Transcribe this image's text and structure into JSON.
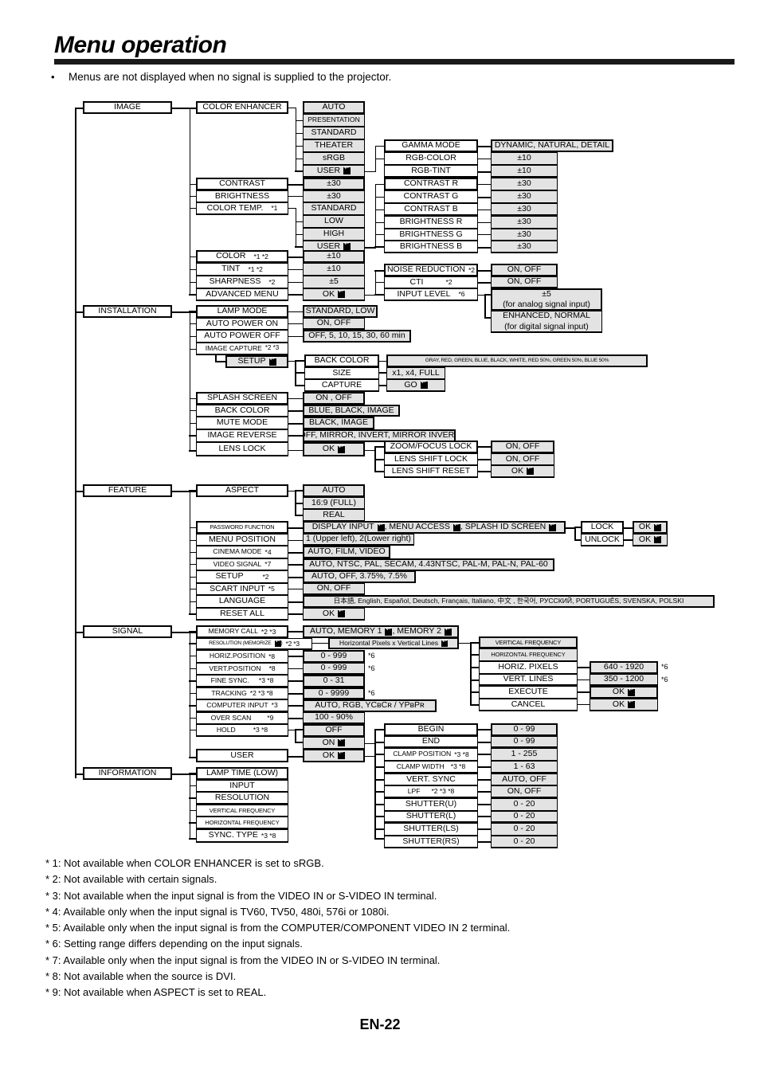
{
  "header": {
    "title": "Menu operation",
    "bullet": "•",
    "note": "Menus are not displayed when no signal is supplied to the projector."
  },
  "page_number": "EN-22",
  "menu": {
    "image": {
      "root": "IMAGE",
      "items": {
        "color_enhancer": "COLOR ENHANCER",
        "contrast": "CONTRAST",
        "brightness": "BRIGHTNESS",
        "color_temp": "COLOR TEMP.",
        "color_temp_note": "*1",
        "color": "COLOR",
        "color_note": "*1 *2",
        "tint": "TINT",
        "tint_note": "*1 *2",
        "sharpness": "SHARPNESS",
        "sharpness_note": "*2",
        "advanced_menu": "ADVANCED MENU"
      },
      "color_enhancer_values": [
        "AUTO",
        "PRESENTATION",
        "STANDARD",
        "THEATER",
        "sRGB"
      ],
      "color_enhancer_user": "USER",
      "contrast_value": "±30",
      "brightness_value": "±30",
      "color_temp_values": [
        "STANDARD",
        "LOW",
        "HIGH"
      ],
      "color_temp_user": "USER",
      "color_value": "±10",
      "tint_value": "±10",
      "sharpness_value": "±5",
      "advanced_menu_value": "OK",
      "user_submenu": [
        {
          "label": "GAMMA MODE",
          "value": "DYNAMIC, NATURAL, DETAIL"
        },
        {
          "label": "RGB-COLOR",
          "value": "±10"
        },
        {
          "label": "RGB-TINT",
          "value": "±10"
        },
        {
          "label": "CONTRAST R",
          "value": "±30"
        },
        {
          "label": "CONTRAST G",
          "value": "±30"
        },
        {
          "label": "CONTRAST B",
          "value": "±30"
        },
        {
          "label": "BRIGHTNESS R",
          "value": "±30"
        },
        {
          "label": "BRIGHTNESS G",
          "value": "±30"
        },
        {
          "label": "BRIGHTNESS B",
          "value": "±30"
        }
      ],
      "advanced_submenu": [
        {
          "label": "NOISE REDUCTION",
          "note": "*2",
          "value": "ON, OFF"
        },
        {
          "label": "CTI",
          "note": "*2",
          "value": "ON, OFF"
        },
        {
          "label": "INPUT LEVEL",
          "note": "*6",
          "value": ""
        }
      ],
      "input_level_analog_line1": "±5",
      "input_level_analog_line2": "(for analog signal input)",
      "input_level_digital_line1": "ENHANCED, NORMAL",
      "input_level_digital_line2": "(for digital signal input)"
    },
    "installation": {
      "root": "INSTALLATION",
      "items": {
        "lamp_mode": "LAMP MODE",
        "auto_power_on": "AUTO POWER ON",
        "auto_power_off": "AUTO POWER OFF",
        "image_capture": "IMAGE CAPTURE",
        "image_capture_note": "*2 *3",
        "setup": "SETUP",
        "splash_screen": "SPLASH SCREEN",
        "back_color": "BACK COLOR",
        "mute_mode": "MUTE MODE",
        "image_reverse": "IMAGE REVERSE",
        "lens_lock": "LENS LOCK"
      },
      "lamp_mode_value": "STANDARD, LOW",
      "auto_power_on_value": "ON, OFF",
      "auto_power_off_value": "OFF,  5,  10,  15,  30,  60 min",
      "capture_submenu": [
        {
          "label": "BACK COLOR",
          "value": "GRAY, RED, GREEN, BLUE, BLACK, WHITE, RED 50%, GREEN 50%, BLUE 50%"
        },
        {
          "label": "SIZE",
          "value": "x1, x4, FULL"
        },
        {
          "label": "CAPTURE",
          "value": "GO"
        }
      ],
      "splash_screen_value": "ON , OFF",
      "back_color_value": "BLUE, BLACK, IMAGE",
      "mute_mode_value": "BLACK, IMAGE",
      "image_reverse_value": "OFF, MIRROR, INVERT, MIRROR INVERT",
      "lens_lock_value": "OK",
      "lens_lock_submenu": [
        {
          "label": "ZOOM/FOCUS LOCK",
          "value": "ON, OFF"
        },
        {
          "label": "LENS SHIFT LOCK",
          "value": "ON, OFF"
        },
        {
          "label": "LENS SHIFT RESET",
          "value": "OK"
        }
      ]
    },
    "feature": {
      "root": "FEATURE",
      "items": {
        "aspect": "ASPECT",
        "password_function": "PASSWORD FUNCTION",
        "menu_position": "MENU POSITION",
        "cinema_mode": "CINEMA MODE",
        "cinema_mode_note": "*4",
        "video_signal": "VIDEO SIGNAL",
        "video_signal_note": "*7",
        "setup": "SETUP",
        "setup_note": "*2",
        "scart_input": "SCART INPUT",
        "scart_input_note": "*5",
        "language": "LANGUAGE",
        "reset_all": "RESET ALL"
      },
      "aspect_values": [
        "AUTO",
        "16:9 (FULL)",
        "REAL"
      ],
      "password_value_part1": "DISPLAY INPUT",
      "password_value_part2": ", MENU ACCESS",
      "password_value_part3": ", SPLASH ID SCREEN",
      "password_lock": "LOCK",
      "password_unlock": "UNLOCK",
      "password_lock_ok": "OK",
      "password_unlock_ok": "OK",
      "menu_position_value": "1 (Upper left), 2(Lower right)",
      "cinema_mode_value": "AUTO, FILM, VIDEO",
      "video_signal_value": "AUTO, NTSC, PAL, SECAM, 4.43NTSC, PAL-M, PAL-N, PAL-60",
      "setup_value": "AUTO, OFF, 3.75%, 7.5%",
      "scart_input_value": "ON, OFF",
      "language_value": "日本語, English, Español, Deutsch, Français, Italiano, 中文 , 한국어, РУССКИЙ, PORTUGUÊS, SVENSKA, POLSKI",
      "reset_all_value": "OK"
    },
    "signal": {
      "root": "SIGNAL",
      "items": {
        "memory_call": "MEMORY CALL",
        "memory_call_note": "*2 *3",
        "resolution_a": "RESOLUTION (MEMORIZE",
        "resolution_b": ")",
        "resolution_note": "*2 *3",
        "horiz_position": "HORIZ.POSITION",
        "horiz_position_note": "*8",
        "vert_position": "VERT.POSITION",
        "vert_position_note": "*8",
        "fine_sync": "FINE SYNC.",
        "fine_sync_note": "*3 *8",
        "tracking": "TRACKING",
        "tracking_note": "*2 *3 *8",
        "computer_input": "COMPUTER INPUT",
        "computer_input_note": "*3",
        "over_scan": "OVER SCAN",
        "over_scan_note": "*9",
        "hold": "HOLD",
        "hold_note": "*3 *8",
        "user": "USER"
      },
      "memory_call_value_a": "AUTO, MEMORY 1",
      "memory_call_value_b": ", MEMORY 2",
      "resolution_value": "Horizontal Pixels x Vertical Lines",
      "horiz_position_value": "0 - 999",
      "horiz_position_tag": "*6",
      "vert_position_value": "0 - 999",
      "vert_position_tag": "*6",
      "fine_sync_value": "0 - 31",
      "tracking_value": "0 - 9999",
      "tracking_tag": "*6",
      "computer_input_value": "AUTO, RGB, YCʙCʀ / YPʙPʀ",
      "over_scan_value": "100 - 90%",
      "hold_value_off": "OFF",
      "hold_value_on": "ON",
      "user_value": "OK",
      "resolution_submenu": [
        {
          "label": "VERTICAL FREQUENCY",
          "value": ""
        },
        {
          "label": "HORIZONTAL FREQUENCY",
          "value": ""
        },
        {
          "label": "HORIZ. PIXELS",
          "value": "640 - 1920",
          "tag": "*6"
        },
        {
          "label": "VERT. LINES",
          "value": "350 - 1200",
          "tag": "*6"
        },
        {
          "label": "EXECUTE",
          "value": "OK"
        },
        {
          "label": "CANCEL",
          "value": "OK"
        }
      ],
      "user_submenu": [
        {
          "label": "BEGIN",
          "note": "",
          "value": "0 - 99"
        },
        {
          "label": "END",
          "note": "",
          "value": "0 - 99"
        },
        {
          "label": "CLAMP POSITION",
          "note": "*3 *8",
          "value": "1 - 255"
        },
        {
          "label": "CLAMP WIDTH",
          "note": "*3 *8",
          "value": "1 - 63"
        },
        {
          "label": "VERT. SYNC",
          "note": "",
          "value": "AUTO, OFF"
        },
        {
          "label": "LPF",
          "note": "*2 *3 *8",
          "value": "ON, OFF"
        },
        {
          "label": "SHUTTER(U)",
          "note": "",
          "value": "0 - 20"
        },
        {
          "label": "SHUTTER(L)",
          "note": "",
          "value": "0 - 20"
        },
        {
          "label": "SHUTTER(LS)",
          "note": "",
          "value": "0 - 20"
        },
        {
          "label": "SHUTTER(RS)",
          "note": "",
          "value": "0 - 20"
        }
      ]
    },
    "information": {
      "root": "INFORMATION",
      "items": [
        {
          "label": "LAMP TIME (LOW)",
          "note": ""
        },
        {
          "label": "INPUT",
          "note": ""
        },
        {
          "label": "RESOLUTION",
          "note": ""
        },
        {
          "label": "VERTICAL FREQUENCY",
          "note": ""
        },
        {
          "label": "HORIZONTAL FREQUENCY",
          "note": ""
        },
        {
          "label": "SYNC. TYPE",
          "note": "*3 *8"
        }
      ]
    }
  },
  "footnotes": [
    "* 1: Not available when COLOR ENHANCER is set to sRGB.",
    "* 2: Not available with certain signals.",
    "* 3: Not available when the input signal is from the VIDEO IN or S-VIDEO IN terminal.",
    "* 4: Available only when the input signal is TV60, TV50, 480i, 576i or 1080i.",
    "* 5: Available only when the input signal is from the COMPUTER/COMPONENT VIDEO IN 2 terminal.",
    "* 6: Setting range differs depending on the input signals.",
    "* 7: Available only when the input signal is from the VIDEO IN or S-VIDEO IN terminal.",
    "* 8: Not available when the source is DVI.",
    "* 9: Not available when ASPECT is set to REAL."
  ]
}
